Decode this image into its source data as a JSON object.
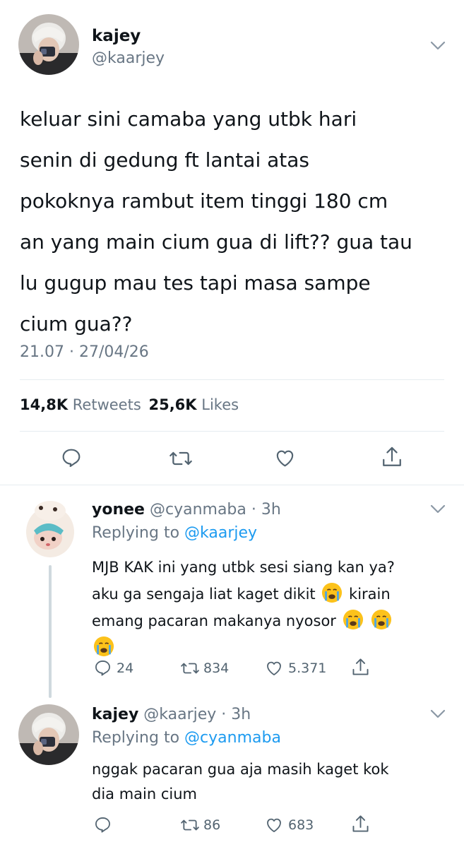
{
  "main_tweet": {
    "name": "kajey",
    "handle": "@kaarjey",
    "text_lines": [
      "keluar sini camaba yang utbk hari",
      "senin di gedung ft lantai atas",
      "pokoknya rambut item tinggi 180 cm",
      "an yang main cium gua di lift?? gua tau",
      "lu gugup mau tes tapi masa sampe",
      "cium gua??"
    ],
    "timestamp": "21.07 · 27/04/26",
    "retweets_count": "14,8K",
    "retweets_label": "Retweets",
    "likes_count": "25,6K",
    "likes_label": "Likes"
  },
  "replies": [
    {
      "name": "yonee",
      "handle_time": "@cyanmaba · 3h",
      "replying_label": "Replying to",
      "replying_to": "@kaarjey",
      "line1": "MJB KAK ini yang utbk sesi siang kan ya?",
      "line2": "aku ga sengaja liat kaget dikit",
      "line2b": "kirain",
      "line3": "emang pacaran makanya nyosor",
      "replies_count": "24",
      "retweets_count": "834",
      "likes_count": "5.371"
    },
    {
      "name": "kajey",
      "handle_time": "@kaarjey · 3h",
      "replying_label": "Replying to",
      "replying_to": "@cyanmaba",
      "line1": "nggak pacaran gua aja masih kaget kok",
      "line2": "dia main cium",
      "retweets_count": "86",
      "likes_count": "683"
    }
  ],
  "icons": [
    "reply-icon",
    "retweet-icon",
    "like-icon",
    "share-icon",
    "chevron-down-icon",
    "crying-emoji-icon"
  ]
}
